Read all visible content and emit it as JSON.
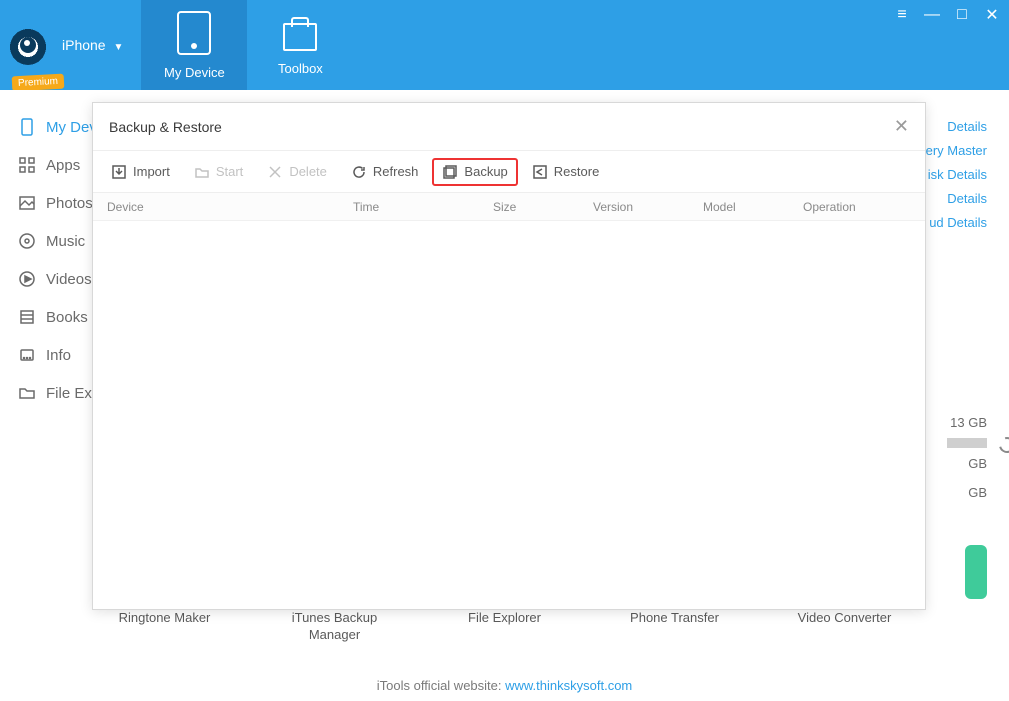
{
  "header": {
    "device_label": "iPhone",
    "premium": "Premium",
    "tabs": {
      "my_device": "My Device",
      "toolbox": "Toolbox"
    }
  },
  "sidebar": {
    "items": [
      "My Device",
      "Apps",
      "Photos",
      "Music",
      "Videos",
      "Books",
      "Info",
      "File Explorer"
    ]
  },
  "rightlinks": [
    "Details",
    "ery Master",
    "isk Details",
    "Details",
    "ud Details"
  ],
  "storage": {
    "line1": "13 GB",
    "line2": "GB",
    "line3": "GB"
  },
  "bottom_tools": [
    "Ringtone Maker",
    "iTunes Backup Manager",
    "File Explorer",
    "Phone Transfer",
    "Video Converter"
  ],
  "footer": {
    "text": "iTools official website: ",
    "link": "www.thinkskysoft.com"
  },
  "modal": {
    "title": "Backup & Restore",
    "toolbar": {
      "import": "Import",
      "start": "Start",
      "delete": "Delete",
      "refresh": "Refresh",
      "backup": "Backup",
      "restore": "Restore"
    },
    "columns": {
      "device": "Device",
      "time": "Time",
      "size": "Size",
      "version": "Version",
      "model": "Model",
      "operation": "Operation"
    }
  }
}
